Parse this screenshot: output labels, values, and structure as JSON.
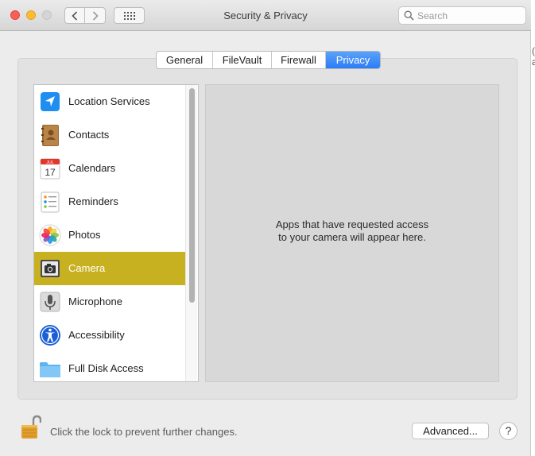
{
  "window": {
    "title": "Security & Privacy",
    "search": {
      "placeholder": "Search",
      "value": ""
    }
  },
  "tabs": [
    {
      "label": "General",
      "active": false
    },
    {
      "label": "FileVault",
      "active": false
    },
    {
      "label": "Firewall",
      "active": false
    },
    {
      "label": "Privacy",
      "active": true
    }
  ],
  "sidebar": {
    "items": [
      {
        "label": "Location Services",
        "icon": "location-arrow-icon",
        "selected": false
      },
      {
        "label": "Contacts",
        "icon": "contacts-book-icon",
        "selected": false
      },
      {
        "label": "Calendars",
        "icon": "calendar-icon",
        "selected": false,
        "icon_text": {
          "month": "JUL",
          "day": "17"
        }
      },
      {
        "label": "Reminders",
        "icon": "reminders-icon",
        "selected": false
      },
      {
        "label": "Photos",
        "icon": "photos-flower-icon",
        "selected": false
      },
      {
        "label": "Camera",
        "icon": "camera-icon",
        "selected": true
      },
      {
        "label": "Microphone",
        "icon": "microphone-icon",
        "selected": false
      },
      {
        "label": "Accessibility",
        "icon": "accessibility-icon",
        "selected": false
      },
      {
        "label": "Full Disk Access",
        "icon": "folder-icon",
        "selected": false
      }
    ]
  },
  "content": {
    "message_line1": "Apps that have requested access",
    "message_line2": "to your camera will appear here."
  },
  "footer": {
    "lock_text": "Click the lock to prevent further changes.",
    "advanced_label": "Advanced...",
    "help_label": "?"
  },
  "background_fragment": {
    "line1": "(",
    "line2": "a"
  },
  "colors": {
    "selection": "#c8b121",
    "tab_active": "#2d7cf6",
    "window_bg": "#ececec"
  }
}
